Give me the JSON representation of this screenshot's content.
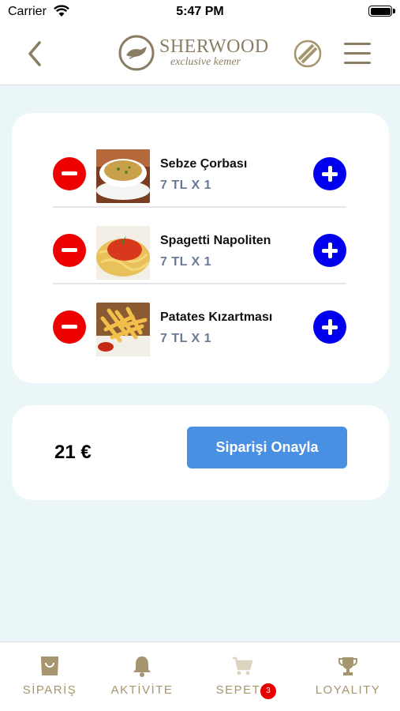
{
  "status_bar": {
    "carrier": "Carrier",
    "time": "5:47 PM"
  },
  "header": {
    "logo_name": "SHERWOOD",
    "logo_tagline": "exclusive kemer"
  },
  "cart": {
    "items": [
      {
        "name": "Sebze Çorbası",
        "price": "7 TL X 1",
        "image": "soup"
      },
      {
        "name": "Spagetti Napoliten",
        "price": "7 TL X 1",
        "image": "spaghetti"
      },
      {
        "name": "Patates Kızartması",
        "price": "7 TL X 1",
        "image": "fries"
      }
    ]
  },
  "summary": {
    "total": "21 €",
    "confirm_label": "Siparişi Onayla"
  },
  "tabs": [
    {
      "label": "SİPARİŞ",
      "icon": "bag-icon"
    },
    {
      "label": "AKTİVİTE",
      "icon": "bell-icon"
    },
    {
      "label": "SEPET",
      "icon": "cart-icon",
      "badge": "3"
    },
    {
      "label": "LOYALITY",
      "icon": "trophy-icon"
    }
  ],
  "colors": {
    "background": "#eaf6f7",
    "accent_gold": "#a6966f",
    "minus_red": "#ee0000",
    "plus_blue": "#0000ee",
    "confirm_blue": "#4a90e2",
    "price_gray_blue": "#6a7a95",
    "badge_red": "#e60000"
  }
}
